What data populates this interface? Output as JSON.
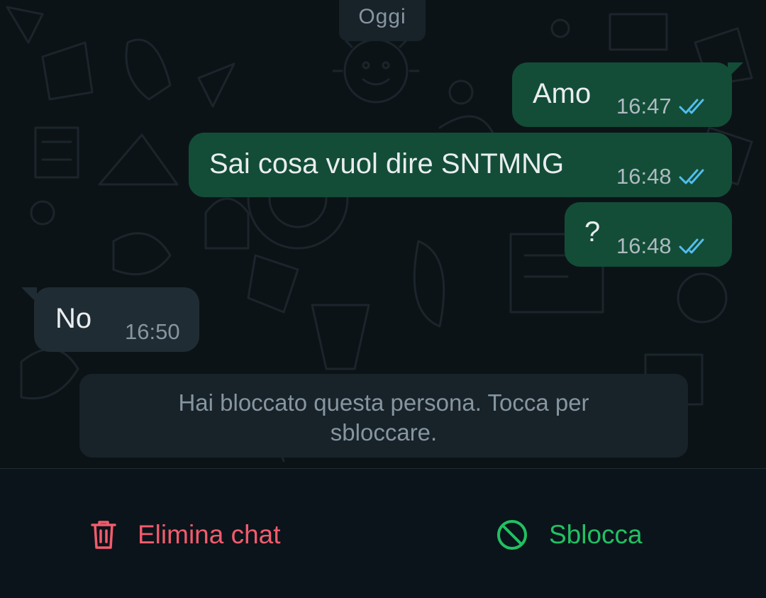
{
  "date_chip": "Oggi",
  "messages": [
    {
      "direction": "out",
      "text": "Amo",
      "time": "16:47",
      "status": "read"
    },
    {
      "direction": "out",
      "text": "Sai cosa vuol dire SNTMNG",
      "time": "16:48",
      "status": "read"
    },
    {
      "direction": "out",
      "text": "?",
      "time": "16:48",
      "status": "read"
    },
    {
      "direction": "in",
      "text": "No",
      "time": "16:50"
    }
  ],
  "blocked_notice": "Hai bloccato questa persona. Tocca per sbloccare.",
  "actions": {
    "delete_label": "Elimina chat",
    "unblock_label": "Sblocca"
  },
  "icons": {
    "delete": "trash-icon",
    "unblock": "block-icon",
    "read_receipt": "double-check-icon"
  },
  "colors": {
    "outgoing_bubble": "#134d37",
    "incoming_bubble": "#202c33",
    "read_ticks": "#53bdeb",
    "delete": "#f15c6d",
    "unblock": "#21c063"
  }
}
